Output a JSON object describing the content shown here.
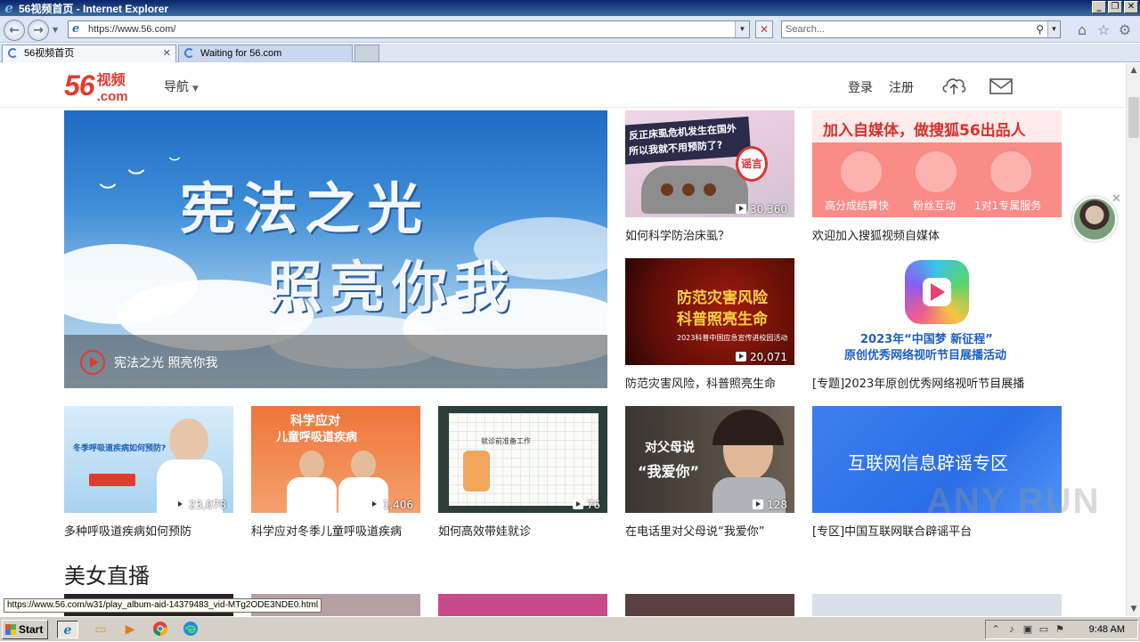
{
  "window": {
    "title": "56视频首页 - Internet Explorer",
    "min_glyph": "_",
    "restore_glyph": "❐",
    "close_glyph": "✕"
  },
  "browser": {
    "address": "https://www.56.com/",
    "search_placeholder": "Search...",
    "tabs": [
      {
        "label": "56视频首页"
      },
      {
        "label": "Waiting for 56.com"
      }
    ]
  },
  "site": {
    "logo_num": "56",
    "logo_cn": "视频",
    "logo_com": ".com",
    "nav_label": "导航",
    "login": "登录",
    "register": "注册"
  },
  "hero": {
    "art_line1": "宪法之光",
    "art_line2": "照亮你我",
    "title": "宪法之光 照亮你我"
  },
  "cards_row1": [
    {
      "title": "如何科学防治床虱？",
      "views": "30,360",
      "thumb_text1": "反正床虱危机发生在国外",
      "thumb_text2": "所以我就不用预防了?",
      "badge": "谣言"
    },
    {
      "title": "欢迎加入搜狐视频自媒体",
      "thumb_text1": "加入自媒体，做搜狐56出品人",
      "features": [
        "高分成结算快",
        "粉丝互动",
        "1对1专属服务"
      ]
    }
  ],
  "cards_row2": [
    {
      "title": "防范灾害风险，科普照亮生命",
      "views": "20,071",
      "thumb_text1": "防范灾害风险",
      "thumb_text2": "科普照亮生命",
      "thumb_text3": "2023科普中国应急宣传进校园活动"
    },
    {
      "title": "[专题]2023年原创优秀网络视听节目展播",
      "thumb_text1": "2023年“中国梦 新征程”",
      "thumb_text2": "原创优秀网络视听节目展播活动"
    }
  ],
  "cards_row3": [
    {
      "title": "多种呼吸道疾病如何预防",
      "views": "23,078",
      "thumb_text1": "冬季呼吸道疾病如何预防?"
    },
    {
      "title": "科学应对冬季儿童呼吸道疾病",
      "views": "1,406",
      "thumb_text1": "科学应对",
      "thumb_text2": "儿童呼吸道疾病"
    },
    {
      "title": "如何高效带娃就诊",
      "views": "76",
      "thumb_text1": "就诊前准备工作"
    },
    {
      "title": "在电话里对父母说“我爱你”",
      "views": "128",
      "thumb_text1": "对父母说",
      "thumb_text2": "“我爱你”"
    },
    {
      "title": "[专区]中国互联网联合辟谣平台",
      "thumb_text1": "互联网信息辟谣专区"
    }
  ],
  "section_live": "美女直播",
  "watermark": "ANY RUN",
  "status_url": "https://www.56.com/w31/play_album-aid-14379483_vid-MTg2ODE3NDE0.html",
  "taskbar": {
    "start": "Start",
    "clock": "9:48 AM"
  },
  "colors": {
    "brand": "#e23b2e",
    "ie_blue": "#dce6f4"
  }
}
